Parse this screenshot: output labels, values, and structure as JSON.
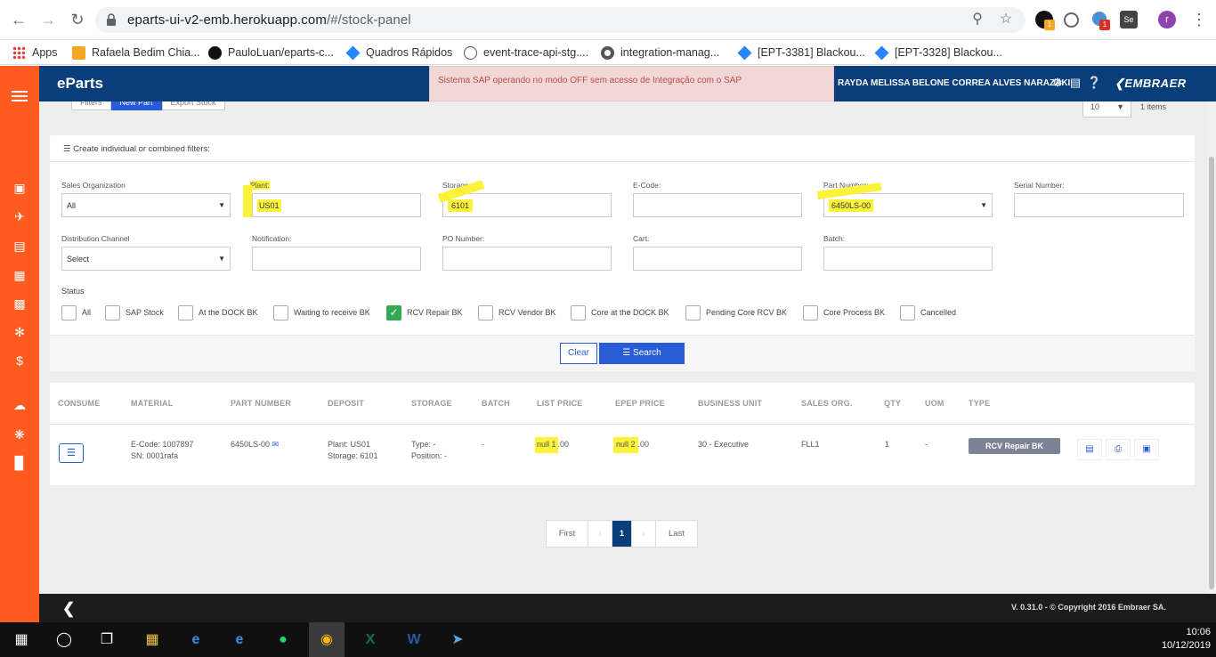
{
  "browser": {
    "url_host": "eparts-ui-v2-emb.herokuapp.com",
    "url_path": "/#/stock-panel",
    "badge_count": "1",
    "badge_count2": "1",
    "ext_label": "Se",
    "profile_initial": "r",
    "bookmarks": [
      {
        "label": "Apps"
      },
      {
        "label": "Rafaela Bedim Chia..."
      },
      {
        "label": "PauloLuan/eparts-c..."
      },
      {
        "label": "Quadros Rápidos"
      },
      {
        "label": "event-trace-api-stg...."
      },
      {
        "label": "integration-manag..."
      },
      {
        "label": "[EPT-3381] Blackou..."
      },
      {
        "label": "[EPT-3328] Blackou..."
      }
    ]
  },
  "header": {
    "brand": "eParts",
    "alert": "Sistema SAP operando no modo OFF sem acesso de Integração com o SAP",
    "user": "RAYDA MELISSA BELONE CORREA ALVES NARAZAKI",
    "logo": "EMBRAER"
  },
  "toolbar": {
    "filters_label": "Filters",
    "new_label": "New Part",
    "export_label": "Export Stock",
    "page_size": "10",
    "items_count": "1 items"
  },
  "filters": {
    "title": "Create individual or combined filters:",
    "sales_org_label": "Sales Organization",
    "sales_org_value": "All",
    "plant_label": "Plant:",
    "plant_value": "US01",
    "storage_label": "Storage:",
    "storage_value": "6101",
    "ecode_label": "E-Code:",
    "part_label": "Part Number:",
    "part_value": "6450LS-00",
    "serial_label": "Serial Number:",
    "dist_label": "Distribution Channel",
    "dist_value": "Select",
    "notification_label": "Notification:",
    "po_label": "PO Number:",
    "cart_label": "Cart:",
    "batch_label": "Batch:",
    "status_label": "Status",
    "status_options": [
      {
        "label": "All",
        "checked": false
      },
      {
        "label": "SAP Stock",
        "checked": false
      },
      {
        "label": "At the DOCK BK",
        "checked": false
      },
      {
        "label": "Waiting to receive BK",
        "checked": false
      },
      {
        "label": "RCV Repair BK",
        "checked": true
      },
      {
        "label": "RCV Vendor BK",
        "checked": false
      },
      {
        "label": "Core at the DOCK BK",
        "checked": false
      },
      {
        "label": "Pending Core RCV BK",
        "checked": false
      },
      {
        "label": "Core Process BK",
        "checked": false
      },
      {
        "label": "Cancelled",
        "checked": false
      }
    ],
    "clear_label": "Clear",
    "search_label": "Search"
  },
  "table": {
    "headers": [
      "CONSUME",
      "MATERIAL",
      "PART NUMBER",
      "DEPOSIT",
      "STORAGE",
      "BATCH",
      "LIST PRICE",
      "EPEP PRICE",
      "BUSINESS UNIT",
      "SALES ORG.",
      "QTY",
      "UOM",
      "TYPE"
    ],
    "row": {
      "material_ecode": "E-Code: 1007897",
      "material_sn": "SN: 0001rafa",
      "part_number": "6450LS-00",
      "deposit_plant": "Plant: US01",
      "deposit_storage": "Storage: 6101",
      "storage_type": "Type: -",
      "storage_position": "Position: -",
      "batch": "-",
      "list_price_prefix": "null 1",
      "list_price_suffix": ".00",
      "epep_price_prefix": "null 2",
      "epep_price_suffix": ".00",
      "business_unit": "30 - Executive",
      "sales_org": "FLL1",
      "qty": "1",
      "uom": "-",
      "type": "RCV Repair BK"
    }
  },
  "pagination": {
    "first": "First",
    "prev": "‹",
    "current": "1",
    "next": "›",
    "last": "Last"
  },
  "footer": {
    "version": "V. 0.31.0 - © Copyright 2016 Embraer SA."
  },
  "taskbar": {
    "time": "10:06",
    "date": "10/12/2019"
  },
  "colors": {
    "sidebar": "#ff5a1f",
    "header": "#0a3e7a",
    "primary": "#2a5bd7",
    "highlight": "#fdf23a"
  }
}
